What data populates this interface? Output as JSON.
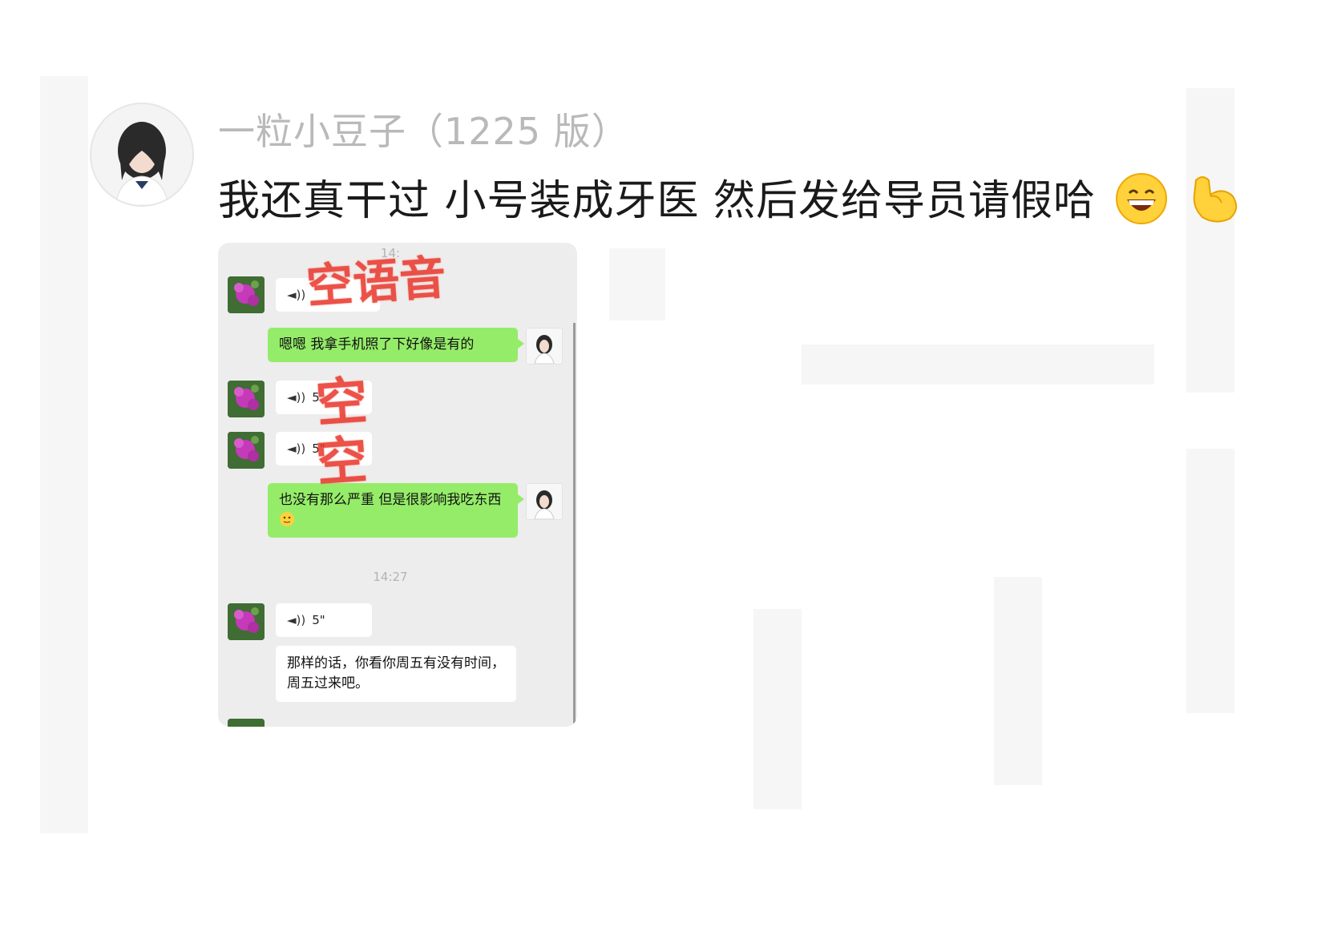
{
  "post": {
    "author": "一粒小豆子（1225 版）",
    "text": "我还真干过 小号装成牙医 然后发给导员请假哈",
    "emojis": [
      "grinning-face-emoji",
      "flexed-biceps-emoji"
    ]
  },
  "chat": {
    "timestamps": [
      "14:",
      "14:27"
    ],
    "voice_messages": [
      {
        "duration": ""
      },
      {
        "duration": "5"
      },
      {
        "duration": "5\""
      },
      {
        "duration": "5\""
      }
    ],
    "my_messages": [
      {
        "text": "嗯嗯 我拿手机照了下好像是有的"
      },
      {
        "text": "也没有那么严重 但是很影响我吃东西"
      }
    ],
    "their_text_message": "那样的话，你看你周五有没有时间，周五过来吧。",
    "stamps": [
      "空语音",
      "空",
      "空"
    ],
    "colors": {
      "background": "#ededed",
      "my_bubble": "#95ec69",
      "their_bubble": "#ffffff",
      "stamp": "#e8342a"
    }
  }
}
